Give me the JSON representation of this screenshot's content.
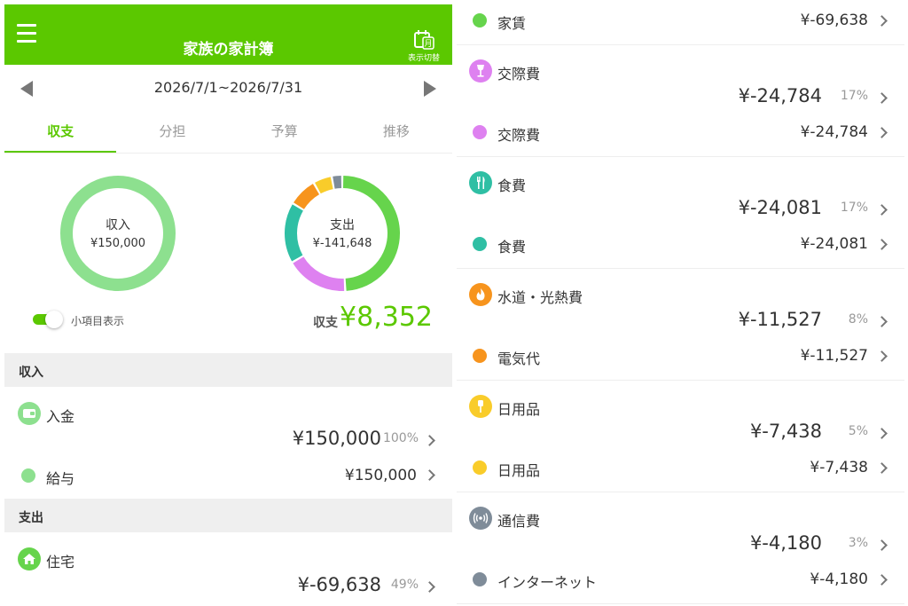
{
  "header": {
    "title": "家族の家計簿",
    "view_toggle_label": "表示切替",
    "calendar_glyph": "月"
  },
  "date_range": "2026/7/1~2026/7/31",
  "tabs": [
    {
      "label": "収支",
      "active": true
    },
    {
      "label": "分担",
      "active": false
    },
    {
      "label": "予算",
      "active": false
    },
    {
      "label": "推移",
      "active": false
    }
  ],
  "income_donut": {
    "label": "収入",
    "amount": "¥150,000",
    "color": "#8de08f"
  },
  "expense_donut": {
    "label": "支出",
    "amount": "¥-141,648",
    "segments": [
      {
        "name": "住宅",
        "value": 69638,
        "color": "#66d44c"
      },
      {
        "name": "交際費",
        "value": 24784,
        "color": "#de81f0"
      },
      {
        "name": "食費",
        "value": 24081,
        "color": "#2fbfa4"
      },
      {
        "name": "水道・光熱費",
        "value": 11527,
        "color": "#f7941d"
      },
      {
        "name": "日用品",
        "value": 7438,
        "color": "#f9cc2a"
      },
      {
        "name": "通信費",
        "value": 4180,
        "color": "#7f8c99"
      }
    ]
  },
  "subitem_toggle": {
    "label": "小項目表示",
    "on": true
  },
  "balance": {
    "label": "収支",
    "value": "¥8,352"
  },
  "income_section": {
    "title": "収入",
    "category": {
      "name": "入金",
      "amount": "¥150,000",
      "percent": "100%",
      "color": "#8de08f",
      "icon": "wallet-icon"
    },
    "item": {
      "name": "給与",
      "amount": "¥150,000",
      "color": "#8de08f"
    }
  },
  "expense_section": {
    "title": "支出",
    "category": {
      "name": "住宅",
      "amount": "¥-69,638",
      "percent": "49%",
      "color": "#66d44c",
      "icon": "house-icon"
    }
  },
  "right_list": [
    {
      "kind": "item",
      "name": "家賃",
      "amount": "¥-69,638",
      "color": "#66d44c"
    },
    {
      "kind": "category",
      "name": "交際費",
      "amount": "¥-24,784",
      "percent": "17%",
      "color": "#de81f0",
      "icon": "wine-glass-icon"
    },
    {
      "kind": "item",
      "name": "交際費",
      "amount": "¥-24,784",
      "color": "#de81f0"
    },
    {
      "kind": "category",
      "name": "食費",
      "amount": "¥-24,081",
      "percent": "17%",
      "color": "#2fbfa4",
      "icon": "fork-knife-icon"
    },
    {
      "kind": "item",
      "name": "食費",
      "amount": "¥-24,081",
      "color": "#2fbfa4"
    },
    {
      "kind": "category",
      "name": "水道・光熱費",
      "amount": "¥-11,527",
      "percent": "8%",
      "color": "#f7941d",
      "icon": "flame-icon"
    },
    {
      "kind": "item",
      "name": "電気代",
      "amount": "¥-11,527",
      "color": "#f7941d"
    },
    {
      "kind": "category",
      "name": "日用品",
      "amount": "¥-7,438",
      "percent": "5%",
      "color": "#f9cc2a",
      "icon": "toothbrush-icon"
    },
    {
      "kind": "item",
      "name": "日用品",
      "amount": "¥-7,438",
      "color": "#f9cc2a"
    },
    {
      "kind": "category",
      "name": "通信費",
      "amount": "¥-4,180",
      "percent": "3%",
      "color": "#7f8c99",
      "icon": "signal-icon"
    },
    {
      "kind": "item",
      "name": "インターネット",
      "amount": "¥-4,180",
      "color": "#7f8c99"
    }
  ]
}
